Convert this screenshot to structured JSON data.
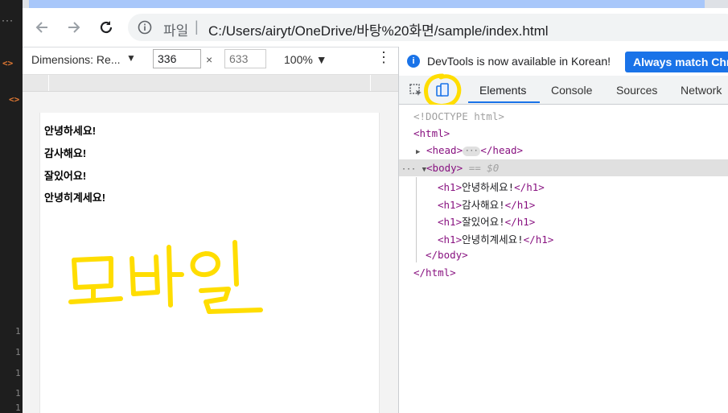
{
  "browser": {
    "scheme_label": "파일",
    "url": "C:/Users/airyt/OneDrive/바탕%20화면/sample/index.html"
  },
  "device_toolbar": {
    "dimensions_label": "Dimensions: Re...",
    "width_value": "336",
    "height_placeholder": "633",
    "times": "×",
    "zoom_label": "100%"
  },
  "page": {
    "headings": [
      "안녕하세요!",
      "감사해요!",
      "잘있어요!",
      "안녕히계세요!"
    ],
    "annotation_handwritten": "모바일"
  },
  "devtools": {
    "info_message": "DevTools is now available in Korean!",
    "info_button": "Always match Chrome",
    "tabs": [
      "Elements",
      "Console",
      "Sources",
      "Network"
    ],
    "active_tab": "Elements",
    "dom": {
      "doctype": "<!DOCTYPE html>",
      "html_open": "<html>",
      "head_open": "<head>",
      "head_close": "</head>",
      "body_open": "<body>",
      "body_marker": "== $0",
      "h1_open": "<h1>",
      "h1_close": "</h1>",
      "children": [
        "안녕하세요!",
        "감사해요!",
        "잘있어요!",
        "안녕히계세요!"
      ],
      "body_close": "</body>",
      "html_close": "</html>"
    }
  },
  "editor": {
    "tag_glyph": "<>",
    "line_numbers": [
      "1",
      "1",
      "1",
      "1",
      "1"
    ]
  },
  "colors": {
    "accent_blue": "#1a73e8",
    "highlight_yellow": "#ffdd00",
    "tag_purple": "#881280"
  }
}
